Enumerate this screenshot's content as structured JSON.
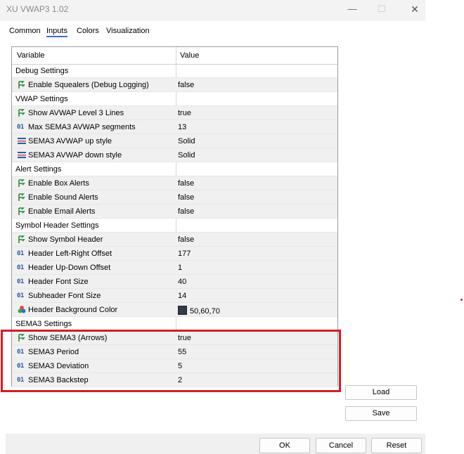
{
  "window": {
    "title": "XU VWAP3 1.02",
    "minimize_glyph": "—",
    "maximize_glyph": "☐",
    "close_glyph": "✕"
  },
  "tabs": [
    {
      "label": "Common",
      "active": false
    },
    {
      "label": "Inputs",
      "active": true
    },
    {
      "label": "Colors",
      "active": false
    },
    {
      "label": "Visualization",
      "active": false
    }
  ],
  "grid": {
    "headers": {
      "variable": "Variable",
      "value": "Value"
    },
    "rows": [
      {
        "kind": "group",
        "name": "Debug Settings",
        "value": ""
      },
      {
        "kind": "param",
        "icon": "bool-icon",
        "name": "Enable Squealers (Debug Logging)",
        "value": "false"
      },
      {
        "kind": "group",
        "name": "VWAP Settings",
        "value": ""
      },
      {
        "kind": "param",
        "icon": "bool-icon",
        "name": "Show AVWAP Level 3 Lines",
        "value": "true"
      },
      {
        "kind": "param",
        "icon": "int-icon",
        "name": "Max SEMA3 AVWAP segments",
        "value": "13"
      },
      {
        "kind": "param",
        "icon": "enum-icon",
        "name": "SEMA3 AVWAP up style",
        "value": "Solid"
      },
      {
        "kind": "param",
        "icon": "enum-icon",
        "name": "SEMA3 AVWAP down style",
        "value": "Solid"
      },
      {
        "kind": "group",
        "name": "Alert Settings",
        "value": ""
      },
      {
        "kind": "param",
        "icon": "bool-icon",
        "name": "Enable Box Alerts",
        "value": "false"
      },
      {
        "kind": "param",
        "icon": "bool-icon",
        "name": "Enable Sound Alerts",
        "value": "false"
      },
      {
        "kind": "param",
        "icon": "bool-icon",
        "name": "Enable Email Alerts",
        "value": "false"
      },
      {
        "kind": "group",
        "name": "Symbol Header Settings",
        "value": ""
      },
      {
        "kind": "param",
        "icon": "bool-icon",
        "name": "Show Symbol Header",
        "value": "false"
      },
      {
        "kind": "param",
        "icon": "int-icon",
        "name": "Header Left-Right Offset",
        "value": "177"
      },
      {
        "kind": "param",
        "icon": "int-icon",
        "name": "Header Up-Down Offset",
        "value": "1"
      },
      {
        "kind": "param",
        "icon": "int-icon",
        "name": "Header Font Size",
        "value": "40"
      },
      {
        "kind": "param",
        "icon": "int-icon",
        "name": "Subheader Font Size",
        "value": "14"
      },
      {
        "kind": "param",
        "icon": "color-icon",
        "name": "Header Background Color",
        "value": "50,60,70",
        "swatch": "#323c46"
      },
      {
        "kind": "group",
        "name": "SEMA3 Settings",
        "value": ""
      },
      {
        "kind": "param",
        "icon": "bool-icon",
        "name": "Show SEMA3 (Arrows)",
        "value": "true"
      },
      {
        "kind": "param",
        "icon": "int-icon",
        "name": "SEMA3 Period",
        "value": "55"
      },
      {
        "kind": "param",
        "icon": "int-icon",
        "name": "SEMA3 Deviation",
        "value": "5"
      },
      {
        "kind": "param",
        "icon": "int-icon",
        "name": "SEMA3 Backstep",
        "value": "2"
      }
    ]
  },
  "side_buttons": {
    "load": "Load",
    "save": "Save"
  },
  "footer_buttons": {
    "ok": "OK",
    "cancel": "Cancel",
    "reset": "Reset"
  },
  "colors": {
    "highlight": "#d21f26",
    "tab_underline": "#3c6fd6"
  }
}
